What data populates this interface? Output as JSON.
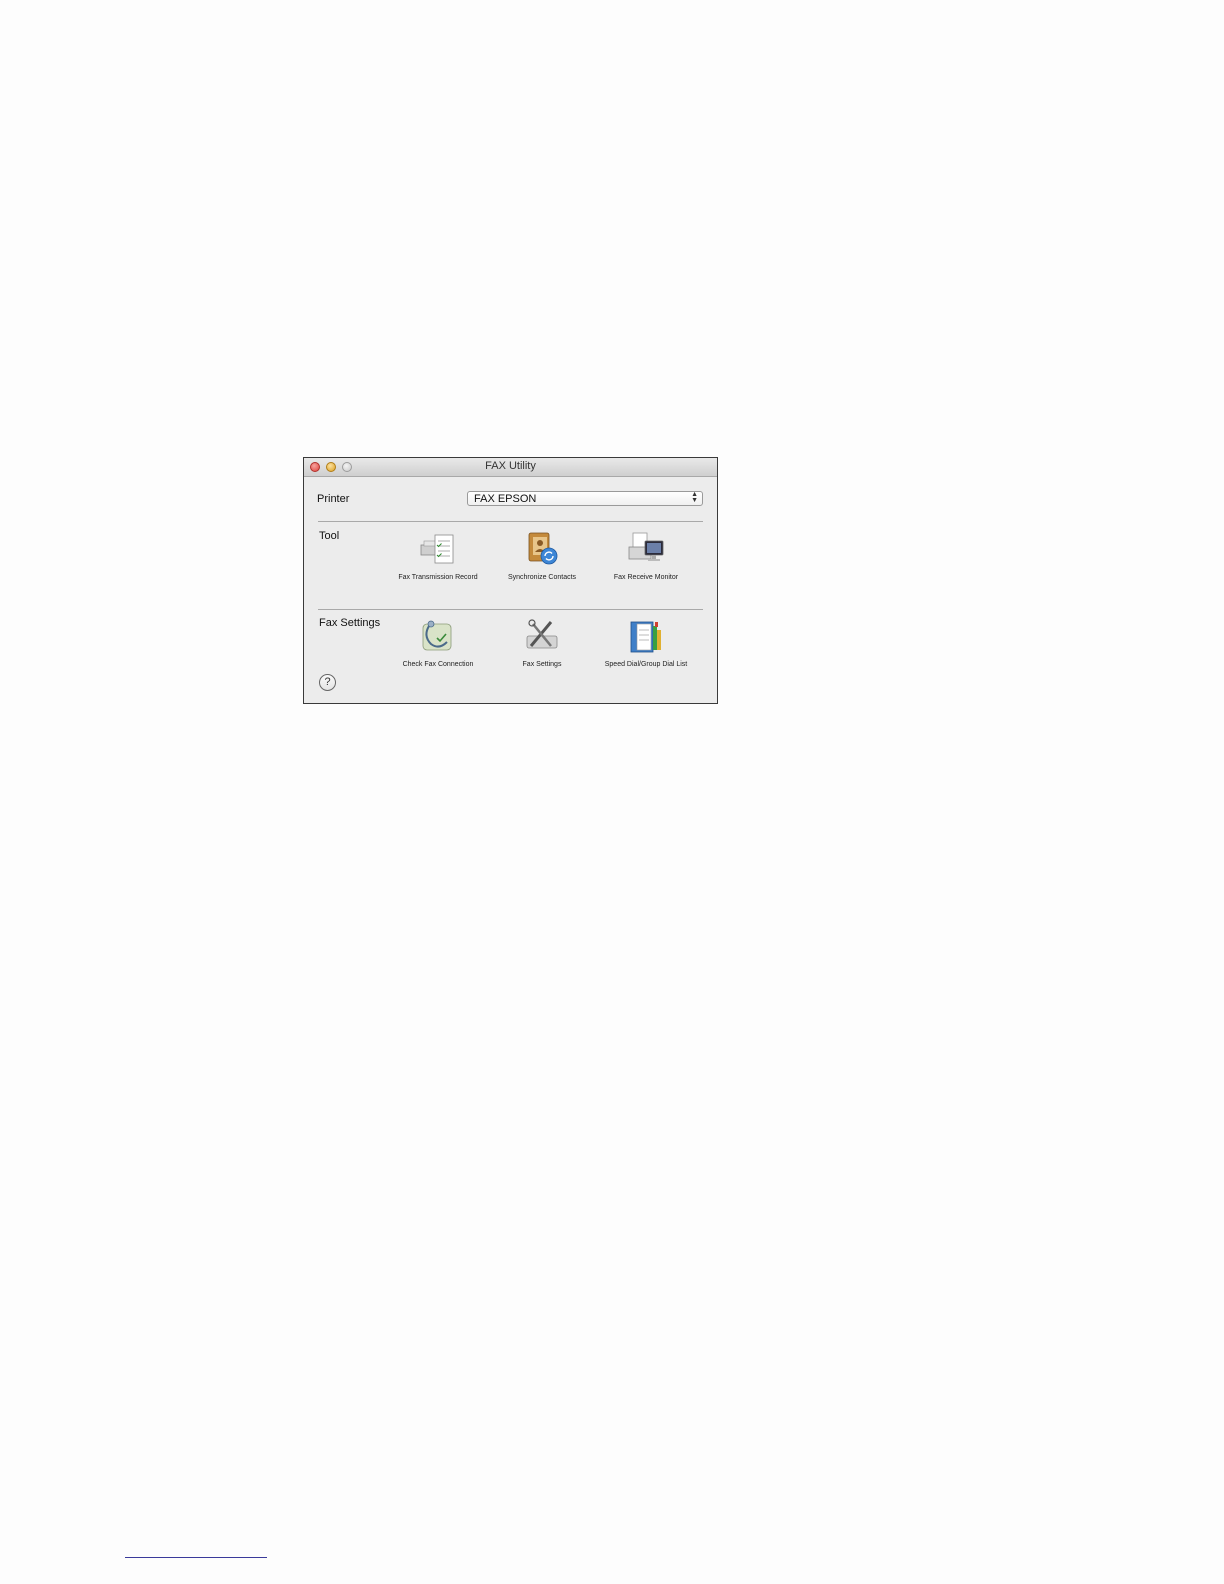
{
  "window": {
    "title": "FAX Utility"
  },
  "printer": {
    "label": "Printer",
    "selected": "FAX EPSON"
  },
  "tool_section": {
    "label": "Tool",
    "items": [
      {
        "label": "Fax Transmission Record",
        "icon": "fax-record-icon"
      },
      {
        "label": "Synchronize Contacts",
        "icon": "sync-contacts-icon"
      },
      {
        "label": "Fax Receive Monitor",
        "icon": "fax-monitor-icon"
      }
    ]
  },
  "settings_section": {
    "label": "Fax Settings",
    "items": [
      {
        "label": "Check Fax Connection",
        "icon": "check-connection-icon"
      },
      {
        "label": "Fax Settings",
        "icon": "fax-settings-icon"
      },
      {
        "label": "Speed Dial/Group Dial List",
        "icon": "speed-dial-icon"
      }
    ]
  },
  "help": {
    "glyph": "?"
  }
}
